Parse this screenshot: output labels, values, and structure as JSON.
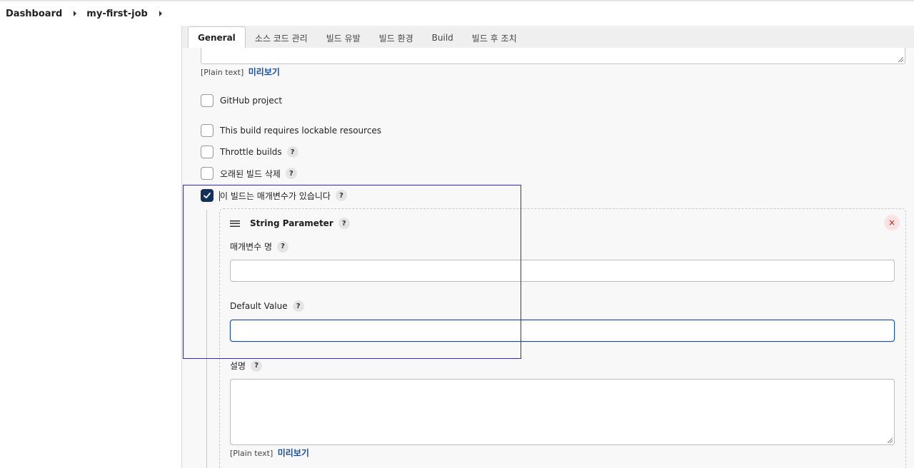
{
  "breadcrumb": {
    "items": [
      "Dashboard",
      "my-first-job"
    ]
  },
  "tabs": [
    {
      "label": "General",
      "active": true
    },
    {
      "label": "소스 코드 관리"
    },
    {
      "label": "빌드 유발"
    },
    {
      "label": "빌드 환경"
    },
    {
      "label": "Build"
    },
    {
      "label": "빌드 후 조치"
    }
  ],
  "description": {
    "format_label": "[Plain text]",
    "preview_label": "미리보기"
  },
  "options": [
    {
      "label": "GitHub project",
      "checked": false,
      "help": false
    },
    {
      "label": "This build requires lockable resources",
      "checked": false,
      "help": false
    },
    {
      "label": "Throttle builds",
      "checked": false,
      "help": true
    },
    {
      "label": "오래된 빌드 삭제",
      "checked": false,
      "help": true
    },
    {
      "label": "이 빌드는 매개변수가 있습니다",
      "checked": true,
      "help": true
    }
  ],
  "help_glyph": "?",
  "parameter": {
    "title": "String Parameter",
    "close_glyph": "×",
    "name_label": "매개변수 명",
    "name_value": "",
    "default_label": "Default Value",
    "default_value": "",
    "desc_label": "설명",
    "format_label": "[Plain text]",
    "preview_label": "미리보기"
  },
  "colors": {
    "accent": "#11305c",
    "link": "#1a4fa0",
    "focus": "#1f4aa0",
    "selection": "#2a2ad4"
  }
}
